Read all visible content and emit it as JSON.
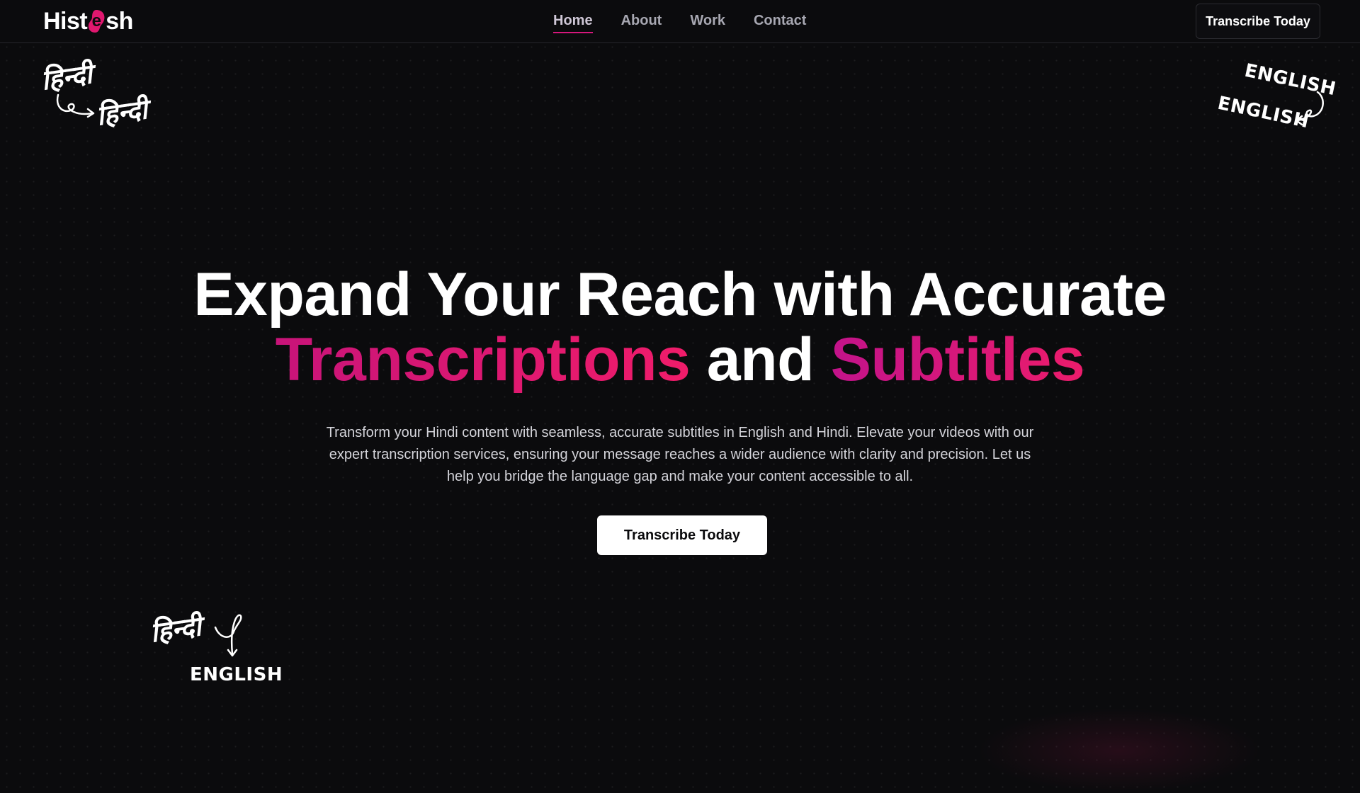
{
  "brand": {
    "logo_text_start": "Hist",
    "logo_text_end": "sh",
    "accent_color": "#e0186f"
  },
  "nav": {
    "items": [
      {
        "label": "Home",
        "active": true
      },
      {
        "label": "About",
        "active": false
      },
      {
        "label": "Work",
        "active": false
      },
      {
        "label": "Contact",
        "active": false
      }
    ],
    "cta_label": "Transcribe Today"
  },
  "hero": {
    "title_line1": "Expand Your Reach with Accurate",
    "title_accent_1": "Transcriptions",
    "title_connector": "and",
    "title_accent_2": "Subtitles",
    "description": "Transform your Hindi content with seamless, accurate subtitles in English and Hindi. Elevate your videos with our expert transcription services, ensuring your message reaches a wider audience with clarity and precision. Let us help you bridge the language gap and make your content accessible to all.",
    "cta_label": "Transcribe Today"
  },
  "decorations": {
    "top_left": {
      "word_1": "हिन्दी",
      "word_2": "हिन्दी"
    },
    "top_right": {
      "word_1": "ENGLISH",
      "word_2": "ENGLISH"
    },
    "bottom_left": {
      "word_1": "हिन्दी",
      "word_2": "ENGLISH"
    }
  }
}
